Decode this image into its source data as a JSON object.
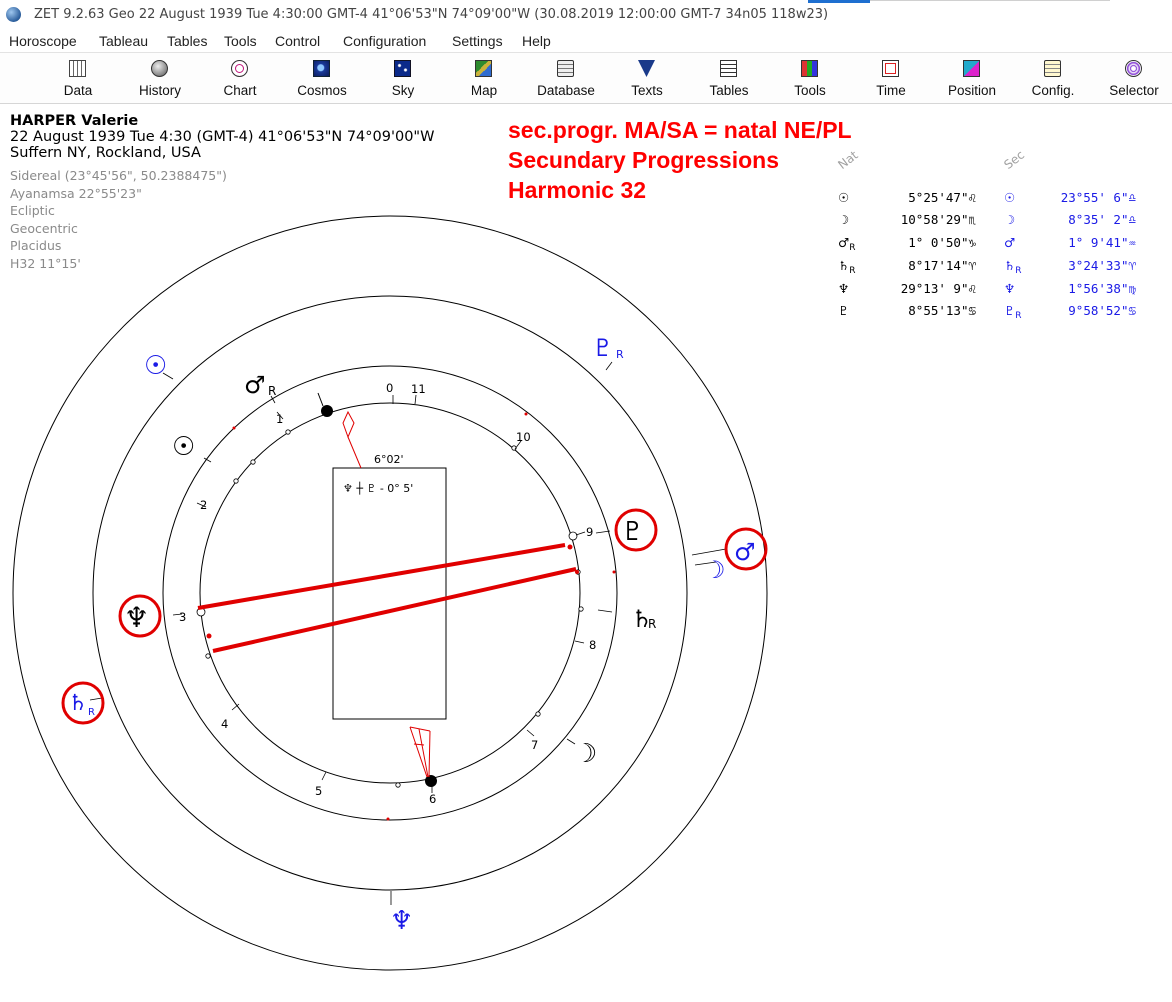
{
  "window": {
    "title": "ZET 9.2.63 Geo   22 August 1939  Tue   4:30:00 GMT-4 41°06'53\"N  74°09'00\"W  (30.08.2019  12:00:00 GMT-7 34n05 118w23)"
  },
  "menu": {
    "items": [
      "Horoscope",
      "Tableau",
      "Tables",
      "Tools",
      "Control",
      "Configuration",
      "Settings",
      "Help"
    ]
  },
  "toolbar": {
    "buttons": [
      {
        "label": "Data",
        "icon": "data-icon"
      },
      {
        "label": "History",
        "icon": "history-icon"
      },
      {
        "label": "Chart",
        "icon": "chart-icon"
      },
      {
        "label": "Cosmos",
        "icon": "cosmos-icon"
      },
      {
        "label": "Sky",
        "icon": "sky-icon"
      },
      {
        "label": "Map",
        "icon": "map-icon"
      },
      {
        "label": "Database",
        "icon": "database-icon"
      },
      {
        "label": "Texts",
        "icon": "texts-icon"
      },
      {
        "label": "Tables",
        "icon": "tables-icon"
      },
      {
        "label": "Tools",
        "icon": "tools-icon"
      },
      {
        "label": "Time",
        "icon": "time-icon"
      },
      {
        "label": "Position",
        "icon": "position-icon"
      },
      {
        "label": "Config.",
        "icon": "config-icon"
      },
      {
        "label": "Selector",
        "icon": "selector-icon"
      }
    ]
  },
  "info": {
    "name": "HARPER Valerie",
    "birth_line": "22 August 1939  Tue   4:30 (GMT-4) 41°06'53\"N  74°09'00\"W",
    "place": "Suffern NY, Rockland, USA",
    "settings": [
      "Sidereal (23°45'56\", 50.2388475\")",
      "Ayanamsa 22°55'23\"",
      "Ecliptic",
      "Geocentric",
      "Placidus",
      "H32  11°15'"
    ]
  },
  "heading": {
    "lines": [
      "sec.progr. MA/SA = natal NE/PL",
      "Secundary Progressions",
      "Harmonic 32"
    ]
  },
  "positions": {
    "nat_header": "Nat",
    "sec_header": "Sec",
    "rows": [
      {
        "nat_glyph": "☉",
        "nat_r": "",
        "nat_value": "5°25'47\"♌",
        "sec_glyph": "☉",
        "sec_r": "",
        "sec_value": "23°55' 6\"♎"
      },
      {
        "nat_glyph": "☽",
        "nat_r": "",
        "nat_value": "10°58'29\"♏",
        "sec_glyph": "☽",
        "sec_r": "",
        "sec_value": "8°35' 2\"♎"
      },
      {
        "nat_glyph": "♂",
        "nat_r": "R",
        "nat_value": "1° 0'50\"♑",
        "sec_glyph": "♂",
        "sec_r": "",
        "sec_value": "1° 9'41\"♒"
      },
      {
        "nat_glyph": "♄",
        "nat_r": "R",
        "nat_value": "8°17'14\"♈",
        "sec_glyph": "♄",
        "sec_r": "R",
        "sec_value": "3°24'33\"♈"
      },
      {
        "nat_glyph": "♆",
        "nat_r": "",
        "nat_value": "29°13' 9\"♌",
        "sec_glyph": "♆",
        "sec_r": "",
        "sec_value": "1°56'38\"♍"
      },
      {
        "nat_glyph": "♇",
        "nat_r": "",
        "nat_value": "8°55'13\"♋",
        "sec_glyph": "♇",
        "sec_r": "R",
        "sec_value": "9°58'52\"♋"
      }
    ]
  },
  "wheel": {
    "house_numbers": [
      "0",
      "11",
      "1",
      "10",
      "2",
      "9",
      "3",
      "8",
      "4",
      "7",
      "5",
      "6"
    ],
    "midpoint_box": {
      "angle": "6°02'",
      "aspect": "♆ ┼ ♇ - 0° 5'"
    },
    "natal_planets": [
      {
        "glyph": "♂",
        "r": "R",
        "name": "mars"
      },
      {
        "glyph": "☉",
        "r": "",
        "name": "sun"
      },
      {
        "glyph": "♆",
        "r": "",
        "name": "neptune"
      },
      {
        "glyph": "♇",
        "r": "",
        "name": "pluto"
      },
      {
        "glyph": "♄",
        "r": "R",
        "name": "saturn"
      },
      {
        "glyph": "☽",
        "r": "",
        "name": "moon"
      }
    ],
    "sec_planets": [
      {
        "glyph": "☉",
        "r": "",
        "name": "sun"
      },
      {
        "glyph": "♇",
        "r": "R",
        "name": "pluto"
      },
      {
        "glyph": "♂",
        "r": "",
        "name": "mars"
      },
      {
        "glyph": "☽",
        "r": "",
        "name": "moon"
      },
      {
        "glyph": "♄",
        "r": "R",
        "name": "saturn"
      },
      {
        "glyph": "♆",
        "r": "",
        "name": "neptune"
      }
    ],
    "colors": {
      "natal": "#000000",
      "secondary": "#1a1ae6",
      "highlight": "#e00000",
      "heading": "#ff0000"
    }
  }
}
